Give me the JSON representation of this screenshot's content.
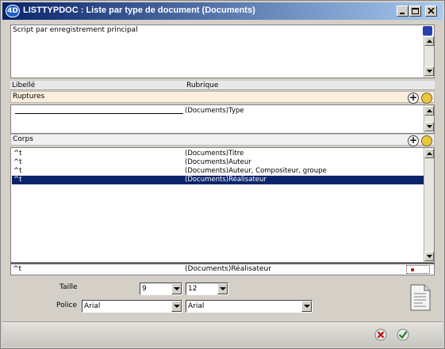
{
  "window": {
    "app_icon": "4D",
    "title": "LISTTYPDOC : Liste par type de document (Documents)"
  },
  "script_panel": {
    "label": "Script par enregistrement principal",
    "icon": "script-icon"
  },
  "columns": {
    "label_header": "Libellé",
    "field_header": "Rubrique"
  },
  "breaks": {
    "title": "Ruptures",
    "rows": [
      {
        "label": "",
        "field": "(Documents)Type"
      }
    ]
  },
  "body": {
    "title": "Corps",
    "rows": [
      {
        "label": "^t",
        "field": "(Documents)Titre",
        "selected": false
      },
      {
        "label": "^t",
        "field": "(Documents)Auteur",
        "selected": false
      },
      {
        "label": "^t",
        "field": "(Documents)Auteur, Compositeur, groupe",
        "selected": false
      },
      {
        "label": "^t",
        "field": "(Documents)Réalisateur",
        "selected": true
      }
    ]
  },
  "footer_row": {
    "label": "^t",
    "field": "(Documents)Réalisateur"
  },
  "size": {
    "label": "Taille",
    "label_value": "9",
    "field_value": "12"
  },
  "font": {
    "label": "Police",
    "label_value": "Arial",
    "field_value": "Arial"
  },
  "colors": {
    "title_bar_start": "#0a246a",
    "title_bar_end": "#a6caf0",
    "selection": "#0a246a",
    "breaks_header": "#fbeedd"
  }
}
